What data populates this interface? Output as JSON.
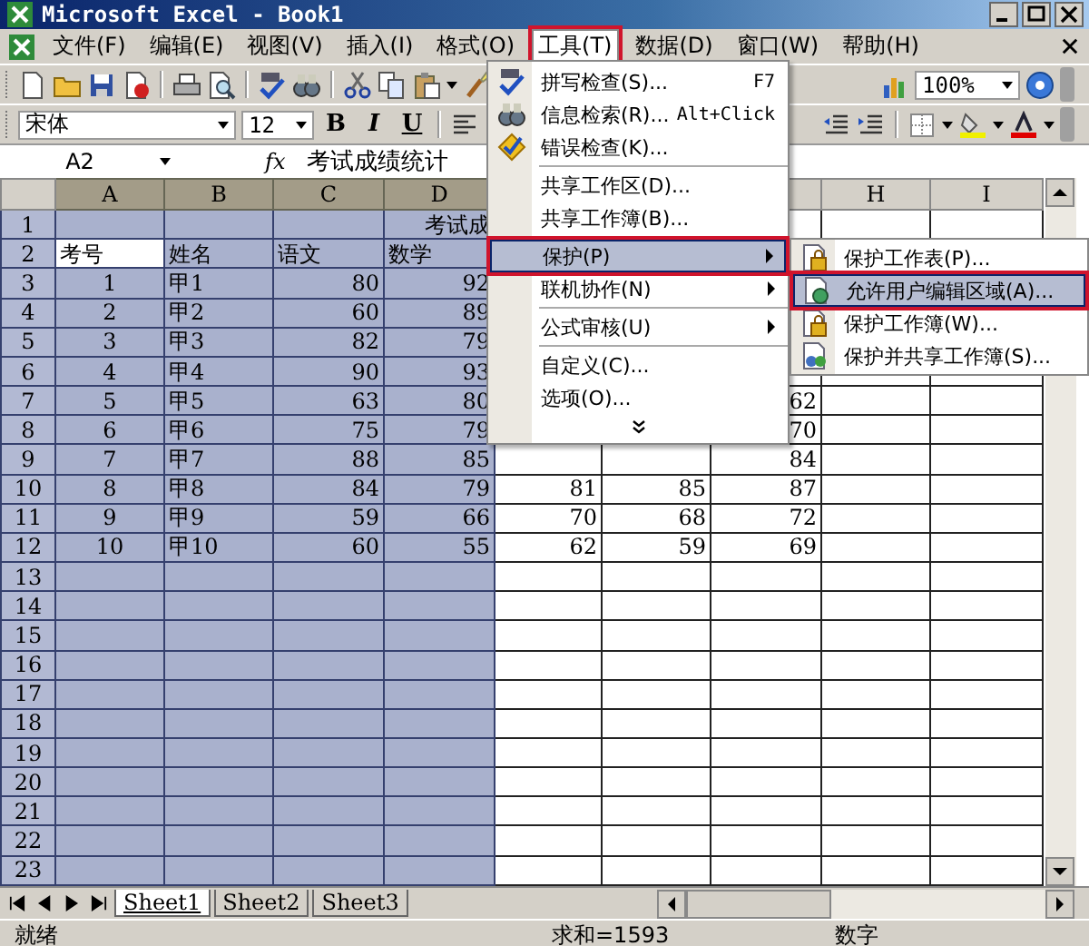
{
  "window": {
    "title": "Microsoft Excel - Book1"
  },
  "menu_bar": [
    {
      "label": "文件(F)",
      "selected": false,
      "outlined": false
    },
    {
      "label": "编辑(E)",
      "selected": false,
      "outlined": false
    },
    {
      "label": "视图(V)",
      "selected": false,
      "outlined": false
    },
    {
      "label": "插入(I)",
      "selected": false,
      "outlined": false
    },
    {
      "label": "格式(O)",
      "selected": false,
      "outlined": false
    },
    {
      "label": "工具(T)",
      "selected": true,
      "outlined": true
    },
    {
      "label": "数据(D)",
      "selected": false,
      "outlined": false
    },
    {
      "label": "窗口(W)",
      "selected": false,
      "outlined": false
    },
    {
      "label": "帮助(H)",
      "selected": false,
      "outlined": false
    }
  ],
  "standard_toolbar": {
    "zoom": "100%"
  },
  "formatting_toolbar": {
    "font": "宋体",
    "size": "12",
    "bold": "B",
    "italic": "I",
    "underline": "U"
  },
  "formula_bar": {
    "name_box": "A2",
    "function_label": "fx",
    "value": "考试成绩统计"
  },
  "columns": [
    {
      "kind": "header",
      "label": "A",
      "selected": true
    },
    {
      "kind": "header",
      "label": "B",
      "selected": true
    },
    {
      "kind": "header",
      "label": "C",
      "selected": true
    },
    {
      "kind": "header",
      "label": "D",
      "selected": true
    },
    {
      "kind": "covered"
    },
    {
      "kind": "covered"
    },
    {
      "kind": "covered"
    },
    {
      "kind": "header",
      "label": "H",
      "selected": false
    },
    {
      "kind": "header",
      "label": "I",
      "selected": false
    }
  ],
  "rows": [
    {
      "header": "1",
      "selected": true,
      "cells": [
        null,
        null,
        null,
        {
          "text": "考试成",
          "kind": "title"
        }
      ]
    },
    {
      "header": "2",
      "selected": true,
      "cells": [
        {
          "text": "考号",
          "kind": "text",
          "active": true
        },
        {
          "text": "姓名",
          "kind": "text"
        },
        {
          "text": "语文",
          "kind": "text"
        },
        {
          "text": "数学",
          "kind": "text"
        }
      ]
    },
    {
      "header": "3",
      "selected": true,
      "cells": [
        {
          "text": "1",
          "kind": "id"
        },
        {
          "text": "甲1",
          "kind": "text"
        },
        {
          "text": "80",
          "kind": "number"
        },
        {
          "text": "92",
          "kind": "number"
        }
      ]
    },
    {
      "header": "4",
      "selected": true,
      "cells": [
        {
          "text": "2",
          "kind": "id"
        },
        {
          "text": "甲2",
          "kind": "text"
        },
        {
          "text": "60",
          "kind": "number"
        },
        {
          "text": "89",
          "kind": "number"
        }
      ]
    },
    {
      "header": "5",
      "selected": true,
      "cells": [
        {
          "text": "3",
          "kind": "id"
        },
        {
          "text": "甲3",
          "kind": "text"
        },
        {
          "text": "82",
          "kind": "number"
        },
        {
          "text": "79",
          "kind": "number"
        }
      ]
    },
    {
      "header": "6",
      "selected": true,
      "cells": [
        {
          "text": "4",
          "kind": "id"
        },
        {
          "text": "甲4",
          "kind": "text"
        },
        {
          "text": "90",
          "kind": "number"
        },
        {
          "text": "93",
          "kind": "number"
        }
      ]
    },
    {
      "header": "7",
      "selected": true,
      "cells": [
        {
          "text": "5",
          "kind": "id"
        },
        {
          "text": "甲5",
          "kind": "text"
        },
        {
          "text": "63",
          "kind": "number"
        },
        {
          "text": "80",
          "kind": "number"
        },
        null,
        null,
        {
          "text": "62",
          "kind": "number"
        }
      ]
    },
    {
      "header": "8",
      "selected": true,
      "cells": [
        {
          "text": "6",
          "kind": "id"
        },
        {
          "text": "甲6",
          "kind": "text"
        },
        {
          "text": "75",
          "kind": "number"
        },
        {
          "text": "79",
          "kind": "number"
        },
        null,
        null,
        {
          "text": "70",
          "kind": "number"
        }
      ]
    },
    {
      "header": "9",
      "selected": true,
      "cells": [
        {
          "text": "7",
          "kind": "id"
        },
        {
          "text": "甲7",
          "kind": "text"
        },
        {
          "text": "88",
          "kind": "number"
        },
        {
          "text": "85",
          "kind": "number"
        },
        null,
        null,
        {
          "text": "84",
          "kind": "number"
        }
      ]
    },
    {
      "header": "10",
      "selected": true,
      "cells": [
        {
          "text": "8",
          "kind": "id"
        },
        {
          "text": "甲8",
          "kind": "text"
        },
        {
          "text": "84",
          "kind": "number"
        },
        {
          "text": "79",
          "kind": "number"
        },
        {
          "text": "81",
          "kind": "number"
        },
        {
          "text": "85",
          "kind": "number"
        },
        {
          "text": "87",
          "kind": "number"
        }
      ]
    },
    {
      "header": "11",
      "selected": true,
      "cells": [
        {
          "text": "9",
          "kind": "id"
        },
        {
          "text": "甲9",
          "kind": "text"
        },
        {
          "text": "59",
          "kind": "number"
        },
        {
          "text": "66",
          "kind": "number"
        },
        {
          "text": "70",
          "kind": "number"
        },
        {
          "text": "68",
          "kind": "number"
        },
        {
          "text": "72",
          "kind": "number"
        }
      ]
    },
    {
      "header": "12",
      "selected": true,
      "cells": [
        {
          "text": "10",
          "kind": "id"
        },
        {
          "text": "甲10",
          "kind": "text"
        },
        {
          "text": "60",
          "kind": "number"
        },
        {
          "text": "55",
          "kind": "number"
        },
        {
          "text": "62",
          "kind": "number"
        },
        {
          "text": "59",
          "kind": "number"
        },
        {
          "text": "69",
          "kind": "number"
        }
      ]
    },
    {
      "header": "13",
      "selected": true,
      "cells": []
    },
    {
      "header": "14",
      "selected": true,
      "cells": []
    },
    {
      "header": "15",
      "selected": true,
      "cells": []
    },
    {
      "header": "16",
      "selected": true,
      "cells": []
    },
    {
      "header": "17",
      "selected": true,
      "cells": []
    },
    {
      "header": "18",
      "selected": true,
      "cells": []
    },
    {
      "header": "19",
      "selected": true,
      "cells": []
    },
    {
      "header": "20",
      "selected": true,
      "cells": []
    },
    {
      "header": "21",
      "selected": true,
      "cells": []
    },
    {
      "header": "22",
      "selected": true,
      "cells": []
    },
    {
      "header": "23",
      "selected": true,
      "cells": []
    }
  ],
  "tools_menu": {
    "items": [
      {
        "kind": "item",
        "label": "拼写检查(S)...",
        "shortcut": "F7",
        "selected": false,
        "outlined": false
      },
      {
        "kind": "item",
        "label": "信息检索(R)...",
        "shortcut": "Alt+Click",
        "selected": false,
        "outlined": false
      },
      {
        "kind": "item",
        "label": "错误检查(K)...",
        "selected": false,
        "outlined": false
      },
      {
        "kind": "separator"
      },
      {
        "kind": "item",
        "label": "共享工作区(D)...",
        "selected": false,
        "outlined": false
      },
      {
        "kind": "item",
        "label": "共享工作簿(B)...",
        "selected": false,
        "outlined": false
      },
      {
        "kind": "separator"
      },
      {
        "kind": "submenu",
        "label": "保护(P)",
        "selected": true,
        "outlined": true
      },
      {
        "kind": "submenu",
        "label": "联机协作(N)",
        "selected": false,
        "outlined": false
      },
      {
        "kind": "separator"
      },
      {
        "kind": "submenu",
        "label": "公式审核(U)",
        "selected": false,
        "outlined": false
      },
      {
        "kind": "separator"
      },
      {
        "kind": "item",
        "label": "自定义(C)...",
        "selected": false,
        "outlined": false
      },
      {
        "kind": "item",
        "label": "选项(O)...",
        "selected": false,
        "outlined": false
      },
      {
        "kind": "expand"
      }
    ]
  },
  "protection_submenu": {
    "items": [
      {
        "label": "保护工作表(P)...",
        "selected": false,
        "outlined": false
      },
      {
        "label": "允许用户编辑区域(A)...",
        "selected": true,
        "outlined": true
      },
      {
        "label": "保护工作簿(W)...",
        "selected": false,
        "outlined": false
      },
      {
        "label": "保护并共享工作簿(S)...",
        "selected": false,
        "outlined": false
      }
    ]
  },
  "sheet_tabs": [
    {
      "label": "Sheet1",
      "selected": true
    },
    {
      "label": "Sheet2",
      "selected": false
    },
    {
      "label": "Sheet3",
      "selected": false
    }
  ],
  "status_bar": {
    "state": "就绪",
    "sum": "求和=1593",
    "mode": "数字"
  }
}
